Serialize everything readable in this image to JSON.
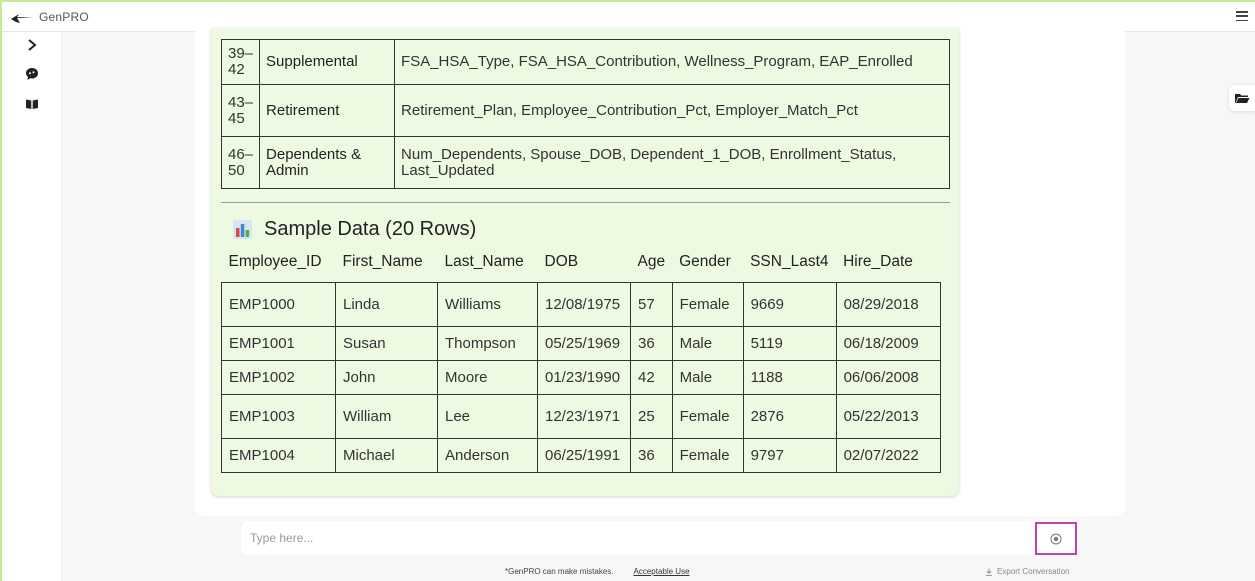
{
  "app": {
    "name": "GenPRO",
    "logo_small_text": "GenPRO"
  },
  "category_table": [
    {
      "range": "39–42",
      "category": "Supplemental",
      "fields": "FSA_HSA_Type, FSA_HSA_Contribution, Wellness_Program, EAP_Enrolled"
    },
    {
      "range": "43–45",
      "category": "Retirement",
      "fields": "Retirement_Plan, Employee_Contribution_Pct, Employer_Match_Pct"
    },
    {
      "range": "46–50",
      "category": "Dependents & Admin",
      "fields": "Num_Dependents, Spouse_DOB, Dependent_1_DOB, Enrollment_Status, Last_Updated"
    }
  ],
  "sample_section": {
    "title": "Sample Data (20 Rows)",
    "icon": "bar-chart-icon",
    "columns": [
      "Employee_ID",
      "First_Name",
      "Last_Name",
      "DOB",
      "Age",
      "Gender",
      "SSN_Last4",
      "Hire_Date"
    ],
    "rows": [
      [
        "EMP1000",
        "Linda",
        "Williams",
        "12/08/1975",
        "57",
        "Female",
        "9669",
        "08/29/2018"
      ],
      [
        "EMP1001",
        "Susan",
        "Thompson",
        "05/25/1969",
        "36",
        "Male",
        "5119",
        "06/18/2009"
      ],
      [
        "EMP1002",
        "John",
        "Moore",
        "01/23/1990",
        "42",
        "Male",
        "1188",
        "06/06/2008"
      ],
      [
        "EMP1003",
        "William",
        "Lee",
        "12/23/1971",
        "25",
        "Female",
        "2876",
        "05/22/2013"
      ],
      [
        "EMP1004",
        "Michael",
        "Anderson",
        "06/25/1991",
        "36",
        "Female",
        "9797",
        "02/07/2022"
      ]
    ]
  },
  "input": {
    "placeholder": "Type here...",
    "value": ""
  },
  "footer": {
    "disclaimer": "*GenPRO can make mistakes.",
    "acceptable_use": "Acceptable Use",
    "export": "Export Conversation"
  },
  "colors": {
    "accent_frame": "#c8e89a",
    "panel_bg": "#eef9e2",
    "send_border": "#c23fb6"
  }
}
